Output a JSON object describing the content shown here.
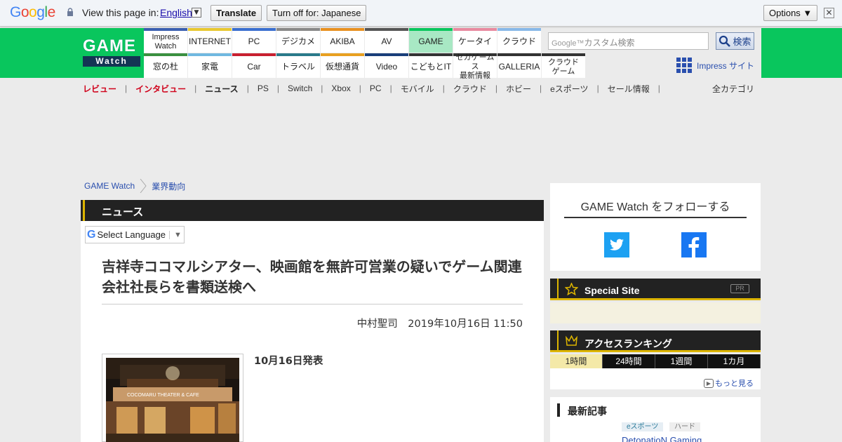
{
  "translate_bar": {
    "brand": "Google",
    "prompt": "View this page in:",
    "language": "English",
    "language_arrow": "▼",
    "translate_label": "Translate",
    "turn_off_label": "Turn off for: Japanese",
    "options_label": "Options ▼",
    "close_label": "✕"
  },
  "header": {
    "logo_top": "GAME",
    "logo_bottom": "Watch",
    "nav_top": [
      {
        "label": "Impress\nWatch",
        "color": "#3a5fb0"
      },
      {
        "label": "INTERNET",
        "color": "#e8c830"
      },
      {
        "label": "PC",
        "color": "#3a6fd0"
      },
      {
        "label": "デジカメ",
        "color": "#888888"
      },
      {
        "label": "AKIBA",
        "color": "#e89020"
      },
      {
        "label": "AV",
        "color": "#555555"
      },
      {
        "label": "GAME",
        "color": "#09c65d"
      },
      {
        "label": "ケータイ",
        "color": "#e88aa0"
      },
      {
        "label": "クラウド",
        "color": "#88b8e8"
      }
    ],
    "nav_bottom": [
      {
        "label": "窓の杜",
        "color": "#3a9040"
      },
      {
        "label": "家電",
        "color": "#70b8e0"
      },
      {
        "label": "Car",
        "color": "#c82030"
      },
      {
        "label": "トラベル",
        "color": "#2a7a8a"
      },
      {
        "label": "仮想通貨",
        "color": "#e8a020"
      },
      {
        "label": "Video",
        "color": "#1a3f7a"
      },
      {
        "label": "こどもとIT",
        "color": "#333333"
      },
      {
        "label": "セガゲームス\n最新情報",
        "color": "#333333"
      },
      {
        "label": "GALLERIA",
        "color": "#333333"
      },
      {
        "label": "クラウド\nゲーム",
        "color": "#333333"
      }
    ],
    "search_placeholder": "カスタム検索",
    "search_brand": "Google™",
    "search_button": "検索",
    "impress_site": "Impress サイト"
  },
  "subnav": {
    "items": [
      {
        "label": "レビュー",
        "color": "#d0021b"
      },
      {
        "label": "インタビュー",
        "color": "#d0021b"
      },
      {
        "label": "ニュース",
        "color": "#222222"
      },
      {
        "label": "PS",
        "color": "#333333"
      },
      {
        "label": "Switch",
        "color": "#333333"
      },
      {
        "label": "Xbox",
        "color": "#333333"
      },
      {
        "label": "PC",
        "color": "#333333"
      },
      {
        "label": "モバイル",
        "color": "#333333"
      },
      {
        "label": "クラウド",
        "color": "#333333"
      },
      {
        "label": "ホビー",
        "color": "#333333"
      },
      {
        "label": "eスポーツ",
        "color": "#333333"
      },
      {
        "label": "セール情報",
        "color": "#333333"
      }
    ],
    "separator": "|",
    "all_categories": "全カテゴリ"
  },
  "breadcrumb": {
    "home": "GAME Watch",
    "category": "業界動向"
  },
  "article": {
    "section": "ニュース",
    "select_language": "Select Language",
    "title": "吉祥寺ココマルシアター、映画館を無許可営業の疑いでゲーム関連会社社長らを書類送検へ",
    "byline": "中村聖司　2019年10月16日 11:50",
    "release": "10月16日発表",
    "photo_sign": "COCOMARU THEATER & CAFE"
  },
  "sidebar": {
    "follow_title": "GAME Watch をフォローする",
    "special_site": "Special Site",
    "pr": "PR",
    "ranking_title": "アクセスランキング",
    "ranking_tabs": [
      "1時間",
      "24時間",
      "1週間",
      "1カ月"
    ],
    "more": "もっと見る",
    "latest_title": "最新記事",
    "latest_tags": [
      "eスポーツ",
      "ハード"
    ],
    "latest_link": "DetonatioN Gaming"
  },
  "colors": {
    "brand_green": "#09c65d",
    "accent_yellow": "#ddb500",
    "link_blue": "#2a4fae"
  }
}
